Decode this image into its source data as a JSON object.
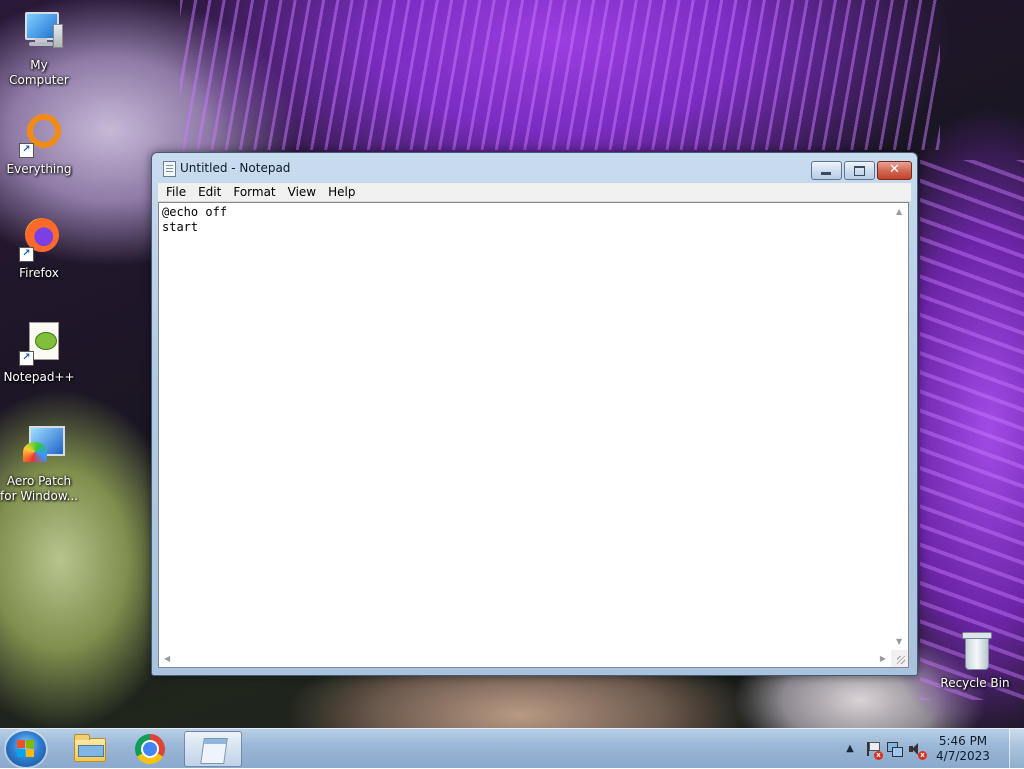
{
  "desktop": {
    "icons": [
      {
        "label": "My Computer",
        "icon": "computer-icon"
      },
      {
        "label": "Everything",
        "icon": "everything-search-icon"
      },
      {
        "label": "Firefox",
        "icon": "firefox-icon"
      },
      {
        "label": "Notepad++",
        "icon": "notepadpp-icon"
      },
      {
        "label": "Aero Patch for Window...",
        "icon": "aero-patch-icon"
      },
      {
        "label": "Recycle Bin",
        "icon": "recycle-bin-icon"
      }
    ]
  },
  "window": {
    "title": "Untitled - Notepad",
    "close_glyph": "✕",
    "menu": [
      "File",
      "Edit",
      "Format",
      "View",
      "Help"
    ],
    "content": "@echo off\nstart"
  },
  "taskbar": {
    "pinned": [
      {
        "name": "Windows Explorer",
        "icon": "folder-icon"
      },
      {
        "name": "Google Chrome",
        "icon": "chrome-icon"
      },
      {
        "name": "Notepad",
        "icon": "notepad-icon",
        "active": true
      }
    ],
    "tray": {
      "chevron": "▲",
      "time": "5:46 PM",
      "date": "4/7/2023"
    }
  }
}
